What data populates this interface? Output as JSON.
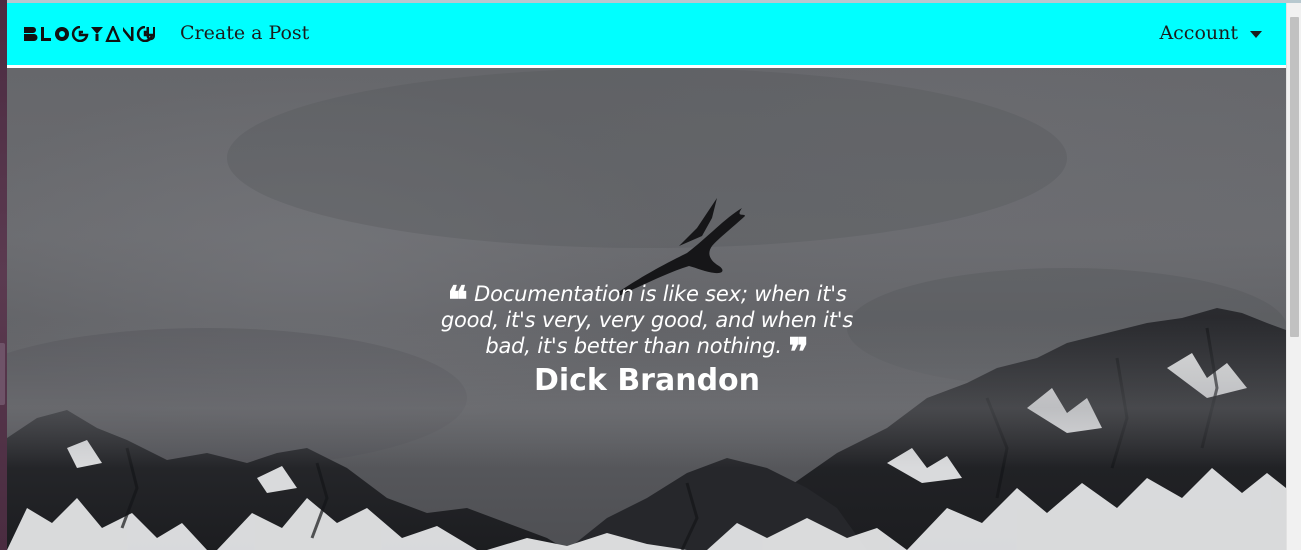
{
  "navbar": {
    "brand": "BLOGYANGU",
    "create_post": "Create a Post",
    "account": "Account",
    "background_color": "#00ffff"
  },
  "hero": {
    "quote": "Documentation is like sex; when it's good, it's very, very good, and when it's bad, it's better than nothing.",
    "open_quote_mark": "❝",
    "close_quote_mark": "❞",
    "author": "Dick Brandon"
  },
  "icons": {
    "dropdown": "caret-down-icon",
    "open_quote": "open-quote-icon",
    "close_quote": "close-quote-icon"
  }
}
